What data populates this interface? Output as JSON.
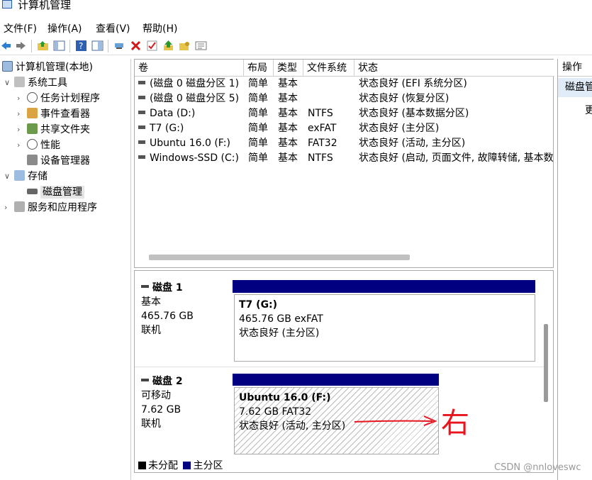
{
  "window": {
    "title": "计算机管理"
  },
  "menu": [
    "文件(F)",
    "操作(A)",
    "查看(V)",
    "帮助(H)"
  ],
  "toolbar": [
    "back-icon",
    "forward-icon",
    "up-folder-icon",
    "show-hide-tree-icon",
    "help-icon",
    "properties-icon",
    "connect-icon",
    "delete-icon",
    "check-icon",
    "up-arrow-icon",
    "folder-key-icon",
    "list-icon"
  ],
  "tree": {
    "root": "计算机管理(本地)",
    "system_tools": "系统工具",
    "task_scheduler": "任务计划程序",
    "event_viewer": "事件查看器",
    "shared_folders": "共享文件夹",
    "performance": "性能",
    "device_manager": "设备管理器",
    "storage": "存储",
    "disk_management": "磁盘管理",
    "services": "服务和应用程序"
  },
  "volumes": {
    "columns": [
      "卷",
      "布局",
      "类型",
      "文件系统",
      "状态"
    ],
    "rows": [
      [
        "(磁盘 0 磁盘分区 1)",
        "简单",
        "基本",
        "",
        "状态良好 (EFI 系统分区)"
      ],
      [
        "(磁盘 0 磁盘分区 5)",
        "简单",
        "基本",
        "",
        "状态良好 (恢复分区)"
      ],
      [
        "Data (D:)",
        "简单",
        "基本",
        "NTFS",
        "状态良好 (基本数据分区)"
      ],
      [
        "T7 (G:)",
        "简单",
        "基本",
        "exFAT",
        "状态良好 (主分区)"
      ],
      [
        "Ubuntu 16.0 (F:)",
        "简单",
        "基本",
        "FAT32",
        "状态良好 (活动, 主分区)"
      ],
      [
        "Windows-SSD (C:)",
        "简单",
        "基本",
        "NTFS",
        "状态良好 (启动, 页面文件, 故障转储, 基本数"
      ]
    ]
  },
  "disks": [
    {
      "name": "磁盘 1",
      "type": "基本",
      "size": "465.76 GB",
      "state": "联机",
      "partition": {
        "title": "T7  (G:)",
        "detail": "465.76 GB exFAT",
        "status": "状态良好 (主分区)"
      }
    },
    {
      "name": "磁盘 2",
      "type": "可移动",
      "size": "7.62 GB",
      "state": "联机",
      "partition": {
        "title": "Ubuntu 16.0  (F:)",
        "detail": "7.62 GB FAT32",
        "status": "状态良好 (活动, 主分区)"
      }
    }
  ],
  "annotation": "右",
  "legend": {
    "unallocated": "未分配",
    "primary": "主分区"
  },
  "actions": {
    "header": "操作",
    "selected": "磁盘管理",
    "more": "更"
  },
  "watermark": "CSDN @nnloveswc",
  "colors": {
    "primary_partition": "#000080",
    "unallocated": "#000000",
    "annotation": "#e8141e"
  }
}
